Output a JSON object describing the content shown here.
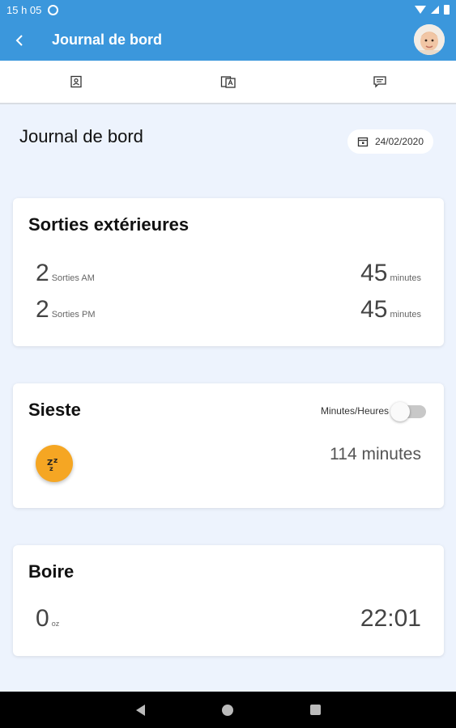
{
  "status_bar": {
    "time": "15 h 05",
    "icons": [
      "notification-circle-icon",
      "wifi-icon",
      "signal-icon",
      "battery-icon"
    ]
  },
  "app_bar": {
    "title": "Journal de bord",
    "back_icon": "chevron-left-icon",
    "avatar": "child-avatar",
    "color": "#3b97dc"
  },
  "tabs": [
    {
      "icon": "profile-card-icon"
    },
    {
      "icon": "journal-book-icon"
    },
    {
      "icon": "chat-message-icon"
    }
  ],
  "header": {
    "title": "Journal de bord",
    "date": "24/02/2020",
    "date_icon": "calendar-icon"
  },
  "outings": {
    "title": "Sorties extérieures",
    "rows": [
      {
        "count": "2",
        "count_label": "Sorties AM",
        "duration": "45",
        "duration_unit": "minutes"
      },
      {
        "count": "2",
        "count_label": "Sorties PM",
        "duration": "45",
        "duration_unit": "minutes"
      }
    ]
  },
  "nap": {
    "title": "Sieste",
    "toggle_label": "Minutes/Heures",
    "toggle_on": false,
    "value": "114 minutes",
    "icon": "sleep-zzz-icon",
    "icon_color": "#f5a623"
  },
  "drink": {
    "title": "Boire",
    "amount": "0",
    "unit": "oz",
    "time": "22:01"
  },
  "nav_bar": {
    "buttons": [
      "back-triangle-icon",
      "home-circle-icon",
      "recents-square-icon"
    ]
  }
}
